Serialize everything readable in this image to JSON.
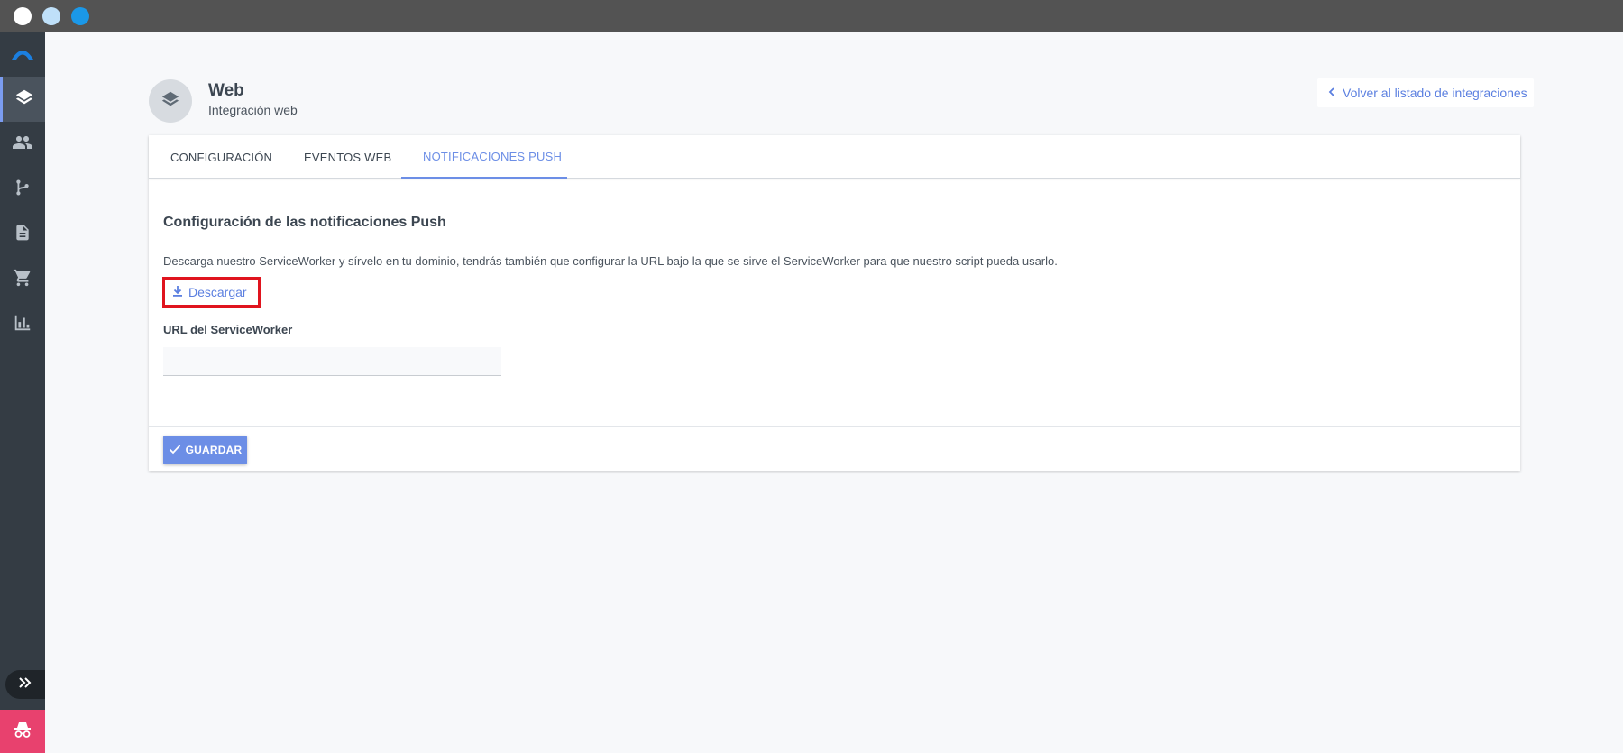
{
  "colors": {
    "accent": "#6c8ee6",
    "sidebar": "#343c44",
    "highlight_box": "#e0141e",
    "incognito": "#e8416e"
  },
  "sidebar": {
    "items": [
      {
        "icon": "layers-icon",
        "active": true
      },
      {
        "icon": "people-icon",
        "active": false
      },
      {
        "icon": "branch-icon",
        "active": false
      },
      {
        "icon": "document-icon",
        "active": false
      },
      {
        "icon": "cart-icon",
        "active": false
      },
      {
        "icon": "bar-chart-icon",
        "active": false
      }
    ]
  },
  "header": {
    "title": "Web",
    "subtitle": "Integración web",
    "back_link": "Volver al listado de integraciones"
  },
  "tabs": [
    {
      "label": "CONFIGURACIÓN",
      "active": false
    },
    {
      "label": "EVENTOS WEB",
      "active": false
    },
    {
      "label": "NOTIFICACIONES PUSH",
      "active": true
    }
  ],
  "push": {
    "title": "Configuración de las notificaciones Push",
    "description": "Descarga nuestro ServiceWorker y sírvelo en tu dominio, tendrás también que configurar la URL bajo la que se sirve el ServiceWorker para que nuestro script pueda usarlo.",
    "download_label": "Descargar",
    "url_label": "URL del ServiceWorker",
    "url_value": "",
    "url_placeholder": ""
  },
  "footer": {
    "save_label": "GUARDAR"
  }
}
